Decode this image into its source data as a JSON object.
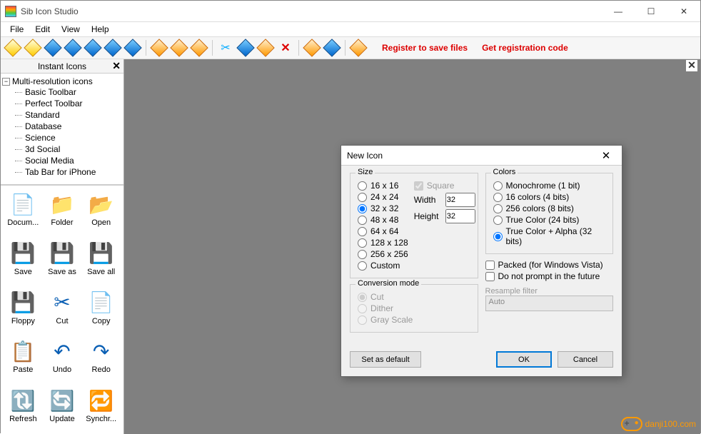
{
  "app": {
    "title": "Sib Icon Studio"
  },
  "menu": [
    "File",
    "Edit",
    "View",
    "Help"
  ],
  "toolbar": {
    "register": "Register to save files",
    "getcode": "Get registration code"
  },
  "sidepanel": {
    "title": "Instant Icons",
    "tree_root": "Multi-resolution icons",
    "tree_items": [
      "Basic Toolbar",
      "Perfect Toolbar",
      "Standard",
      "Database",
      "Science",
      "3d Social",
      "Social Media",
      "Tab Bar for iPhone"
    ],
    "icons": [
      {
        "label": "Docum...",
        "glyph": "📄"
      },
      {
        "label": "Folder",
        "glyph": "📁"
      },
      {
        "label": "Open",
        "glyph": "📂"
      },
      {
        "label": "Save",
        "glyph": "💾"
      },
      {
        "label": "Save as",
        "glyph": "💾"
      },
      {
        "label": "Save all",
        "glyph": "💾"
      },
      {
        "label": "Floppy",
        "glyph": "💾"
      },
      {
        "label": "Cut",
        "glyph": "✂"
      },
      {
        "label": "Copy",
        "glyph": "📄"
      },
      {
        "label": "Paste",
        "glyph": "📋"
      },
      {
        "label": "Undo",
        "glyph": "↶"
      },
      {
        "label": "Redo",
        "glyph": "↷"
      },
      {
        "label": "Refresh",
        "glyph": "🔃"
      },
      {
        "label": "Update",
        "glyph": "🔄"
      },
      {
        "label": "Synchr...",
        "glyph": "🔁"
      }
    ]
  },
  "dialog": {
    "title": "New Icon",
    "size_legend": "Size",
    "sizes": [
      "16 x 16",
      "24 x 24",
      "32 x 32",
      "48 x 48",
      "64 x 64",
      "128 x 128",
      "256 x 256",
      "Custom"
    ],
    "size_selected": "32 x 32",
    "square": "Square",
    "width_label": "Width",
    "height_label": "Height",
    "width_value": "32",
    "height_value": "32",
    "conv_legend": "Conversion mode",
    "conv_options": [
      "Cut",
      "Dither",
      "Gray Scale"
    ],
    "colors_legend": "Colors",
    "color_options": [
      "Monochrome (1 bit)",
      "16 colors (4 bits)",
      "256 colors (8 bits)",
      "True Color (24 bits)",
      "True Color + Alpha (32 bits)"
    ],
    "color_selected": "True Color + Alpha (32 bits)",
    "packed": "Packed (for Windows Vista)",
    "noprompt": "Do not prompt in the future",
    "resample_label": "Resample filter",
    "resample_value": "Auto",
    "btn_default": "Set as default",
    "btn_ok": "OK",
    "btn_cancel": "Cancel"
  },
  "watermark": "danji100.com"
}
